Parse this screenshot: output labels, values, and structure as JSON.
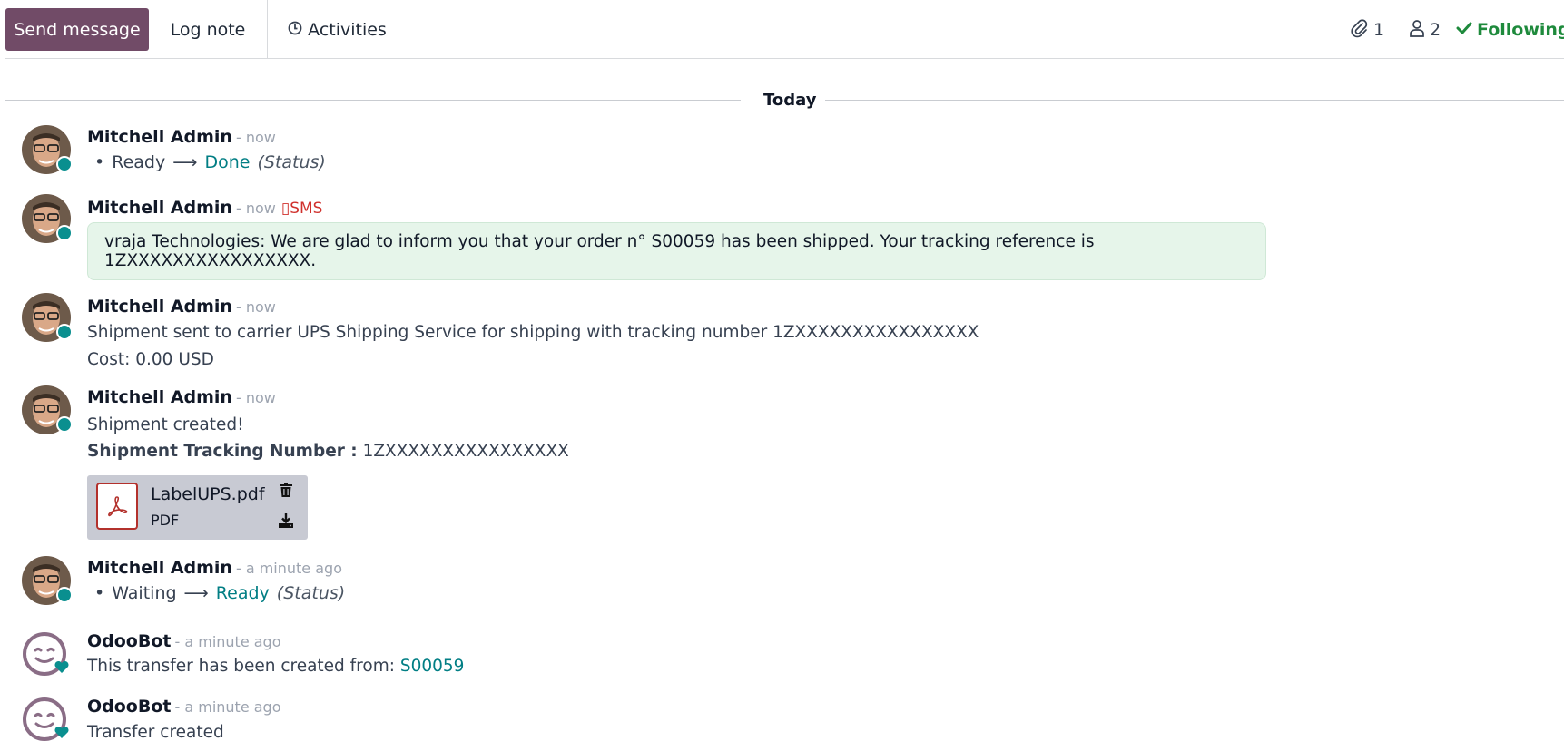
{
  "toolbar": {
    "send_label": "Send message",
    "log_label": "Log note",
    "activities_label": "Activities",
    "attachments_count": "1",
    "followers_count": "2",
    "following_label": "Following"
  },
  "separator": {
    "label": "Today"
  },
  "messages": [
    {
      "author": "Mitchell Admin",
      "time": "- now",
      "old": "Ready",
      "new": "Done",
      "field": "(Status)"
    },
    {
      "author": "Mitchell Admin",
      "time": "- now",
      "tag": "SMS",
      "body": "vraja Technologies: We are glad to inform you that your order n° S00059 has been shipped. Your tracking reference is 1ZXXXXXXXXXXXXXXXX."
    },
    {
      "author": "Mitchell Admin",
      "time": "- now",
      "line1": "Shipment sent to carrier UPS Shipping Service for shipping with tracking number 1ZXXXXXXXXXXXXXXXX",
      "line2": "Cost: 0.00 USD"
    },
    {
      "author": "Mitchell Admin",
      "time": "- now",
      "line1": "Shipment created!",
      "line2_label": "Shipment Tracking Number :",
      "line2_value": " 1ZXXXXXXXXXXXXXXXX",
      "attachment": {
        "name": "LabelUPS.pdf",
        "ext": "PDF"
      }
    },
    {
      "author": "Mitchell Admin",
      "time": "- a minute ago",
      "old": "Waiting",
      "new": "Ready",
      "field": "(Status)"
    },
    {
      "author": "OdooBot",
      "time": "- a minute ago",
      "line1": "This transfer has been created from: ",
      "link": "S00059"
    },
    {
      "author": "OdooBot",
      "time": "- a minute ago",
      "line1": "Transfer created"
    }
  ],
  "colors": {
    "brand": "#714b67",
    "teal": "#017e84",
    "following": "#1e8a3c",
    "sms": "#d0312d",
    "sms_bg": "#e6f5ea"
  }
}
